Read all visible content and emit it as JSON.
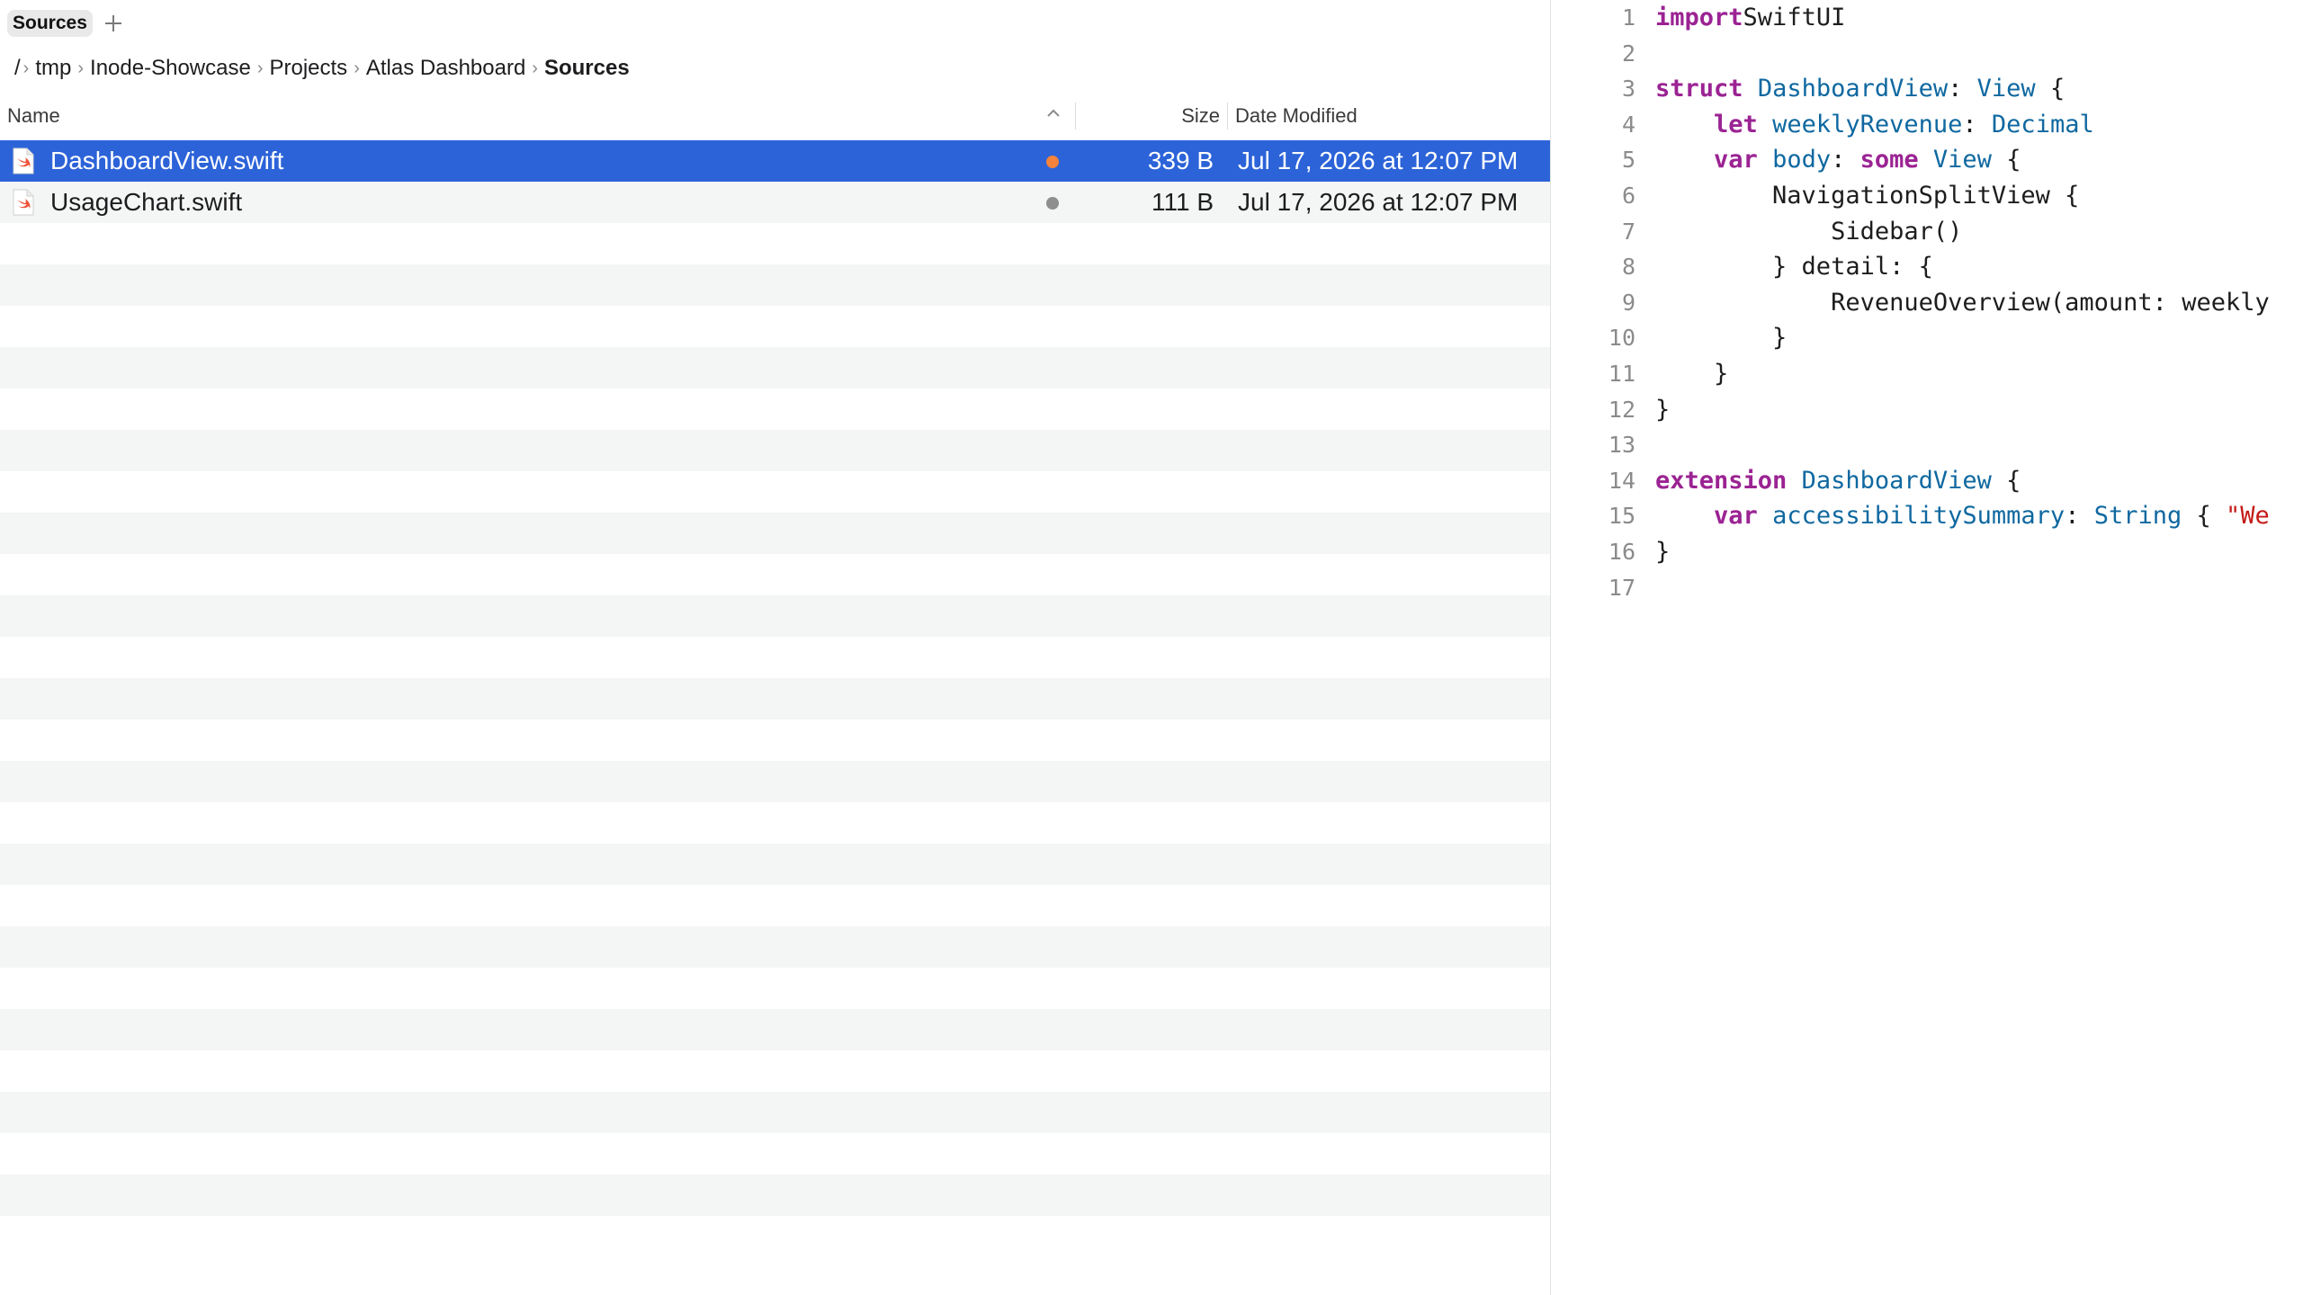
{
  "tabs": [
    {
      "label": "Sources",
      "active": true
    }
  ],
  "breadcrumb": {
    "root": "/",
    "items": [
      "tmp",
      "Inode-Showcase",
      "Projects",
      "Atlas Dashboard"
    ],
    "current": "Sources"
  },
  "columns": {
    "name": "Name",
    "size": "Size",
    "date": "Date Modified"
  },
  "files": [
    {
      "name": "DashboardView.swift",
      "size": "339 B",
      "date": "Jul 17, 2026 at 12:07 PM",
      "selected": true,
      "status_color": "#f5833c",
      "icon": "swift-file-icon"
    },
    {
      "name": "UsageChart.swift",
      "size": "111 B",
      "date": "Jul 17, 2026 at 12:07 PM",
      "selected": false,
      "status_color": "#8e8e8e",
      "icon": "swift-file-icon"
    }
  ],
  "colors": {
    "selection": "#2c63d8",
    "keyword": "#9b2393",
    "type": "#0f68a0",
    "string": "#c41a16"
  },
  "editor": {
    "lines": [
      {
        "n": "1",
        "tokens": [
          [
            "kw",
            "import"
          ],
          [
            "",
            "SwiftUI"
          ]
        ]
      },
      {
        "n": "2",
        "tokens": []
      },
      {
        "n": "3",
        "tokens": [
          [
            "kw",
            "struct"
          ],
          [
            "",
            " "
          ],
          [
            "ty",
            "DashboardView"
          ],
          [
            "",
            ": "
          ],
          [
            "ty",
            "View"
          ],
          [
            "",
            " {"
          ]
        ]
      },
      {
        "n": "4",
        "tokens": [
          [
            "",
            "    "
          ],
          [
            "kw",
            "let"
          ],
          [
            "",
            " "
          ],
          [
            "ty",
            "weeklyRevenue"
          ],
          [
            "",
            ": "
          ],
          [
            "ty",
            "Decimal"
          ]
        ]
      },
      {
        "n": "5",
        "tokens": [
          [
            "",
            "    "
          ],
          [
            "kw",
            "var"
          ],
          [
            "",
            " "
          ],
          [
            "ty",
            "body"
          ],
          [
            "",
            ": "
          ],
          [
            "kw",
            "some"
          ],
          [
            "",
            " "
          ],
          [
            "ty",
            "View"
          ],
          [
            "",
            " {"
          ]
        ]
      },
      {
        "n": "6",
        "tokens": [
          [
            "",
            "        NavigationSplitView {"
          ]
        ]
      },
      {
        "n": "7",
        "tokens": [
          [
            "",
            "            Sidebar()"
          ]
        ]
      },
      {
        "n": "8",
        "tokens": [
          [
            "",
            "        } detail: {"
          ]
        ]
      },
      {
        "n": "9",
        "tokens": [
          [
            "",
            "            RevenueOverview(amount: weekly"
          ]
        ]
      },
      {
        "n": "10",
        "tokens": [
          [
            "",
            "        }"
          ]
        ]
      },
      {
        "n": "11",
        "tokens": [
          [
            "",
            "    }"
          ]
        ]
      },
      {
        "n": "12",
        "tokens": [
          [
            "",
            "}"
          ]
        ]
      },
      {
        "n": "13",
        "tokens": []
      },
      {
        "n": "14",
        "tokens": [
          [
            "kw",
            "extension"
          ],
          [
            "",
            " "
          ],
          [
            "ty",
            "DashboardView"
          ],
          [
            "",
            " {"
          ]
        ]
      },
      {
        "n": "15",
        "tokens": [
          [
            "",
            "    "
          ],
          [
            "kw",
            "var"
          ],
          [
            "",
            " "
          ],
          [
            "ty",
            "accessibilitySummary"
          ],
          [
            "",
            ": "
          ],
          [
            "ty",
            "String"
          ],
          [
            "",
            " { "
          ],
          [
            "str",
            "\"We"
          ]
        ]
      },
      {
        "n": "16",
        "tokens": [
          [
            "",
            "}"
          ]
        ]
      },
      {
        "n": "17",
        "tokens": []
      }
    ]
  }
}
